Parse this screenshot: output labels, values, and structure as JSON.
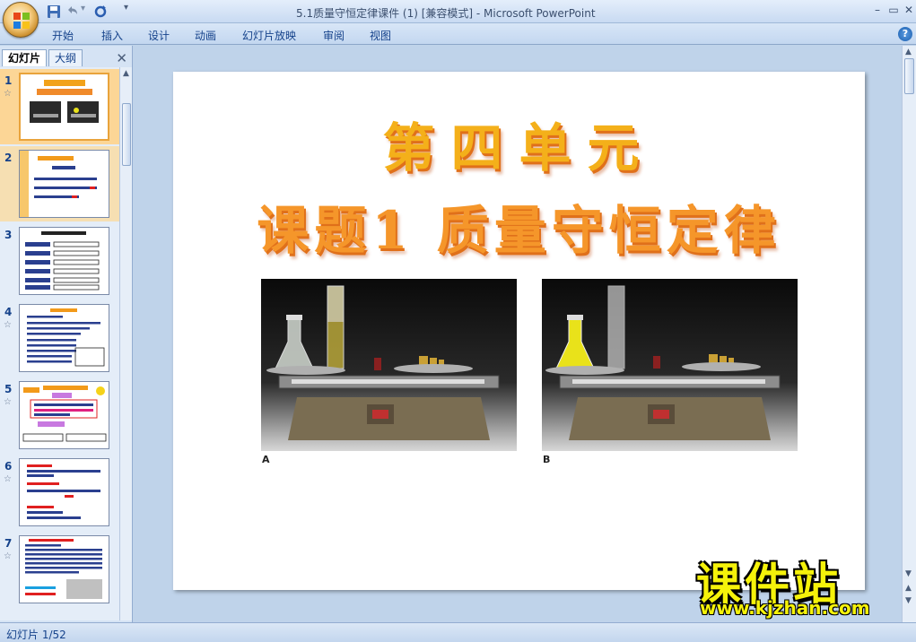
{
  "window": {
    "title": "5.1质量守恒定律课件 (1) [兼容模式] - Microsoft PowerPoint"
  },
  "ribbon": {
    "tabs": [
      "开始",
      "插入",
      "设计",
      "动画",
      "幻灯片放映",
      "审阅",
      "视图"
    ]
  },
  "panel": {
    "tabs": [
      "幻灯片",
      "大纲"
    ],
    "thumbnails": [
      {
        "num": "1",
        "selected": true
      },
      {
        "num": "2",
        "selected": true
      },
      {
        "num": "3",
        "selected": false
      },
      {
        "num": "4",
        "selected": false
      },
      {
        "num": "5",
        "selected": false
      },
      {
        "num": "6",
        "selected": false
      },
      {
        "num": "7",
        "selected": false
      }
    ]
  },
  "slide": {
    "title": "第四单元",
    "subtitle": "课题1 质量守恒定律",
    "photos": [
      {
        "label": "A",
        "liquid_color": "#d9d9c8"
      },
      {
        "label": "B",
        "liquid_color": "#e9e21a"
      }
    ]
  },
  "status": {
    "text": "幻灯片 1/52"
  },
  "watermark": {
    "title": "课件站",
    "url": "www.kjzhan.com"
  },
  "colors": {
    "accent": "#15428b",
    "selected_thumb": "#fcd696",
    "headline": "#f4b01a"
  }
}
